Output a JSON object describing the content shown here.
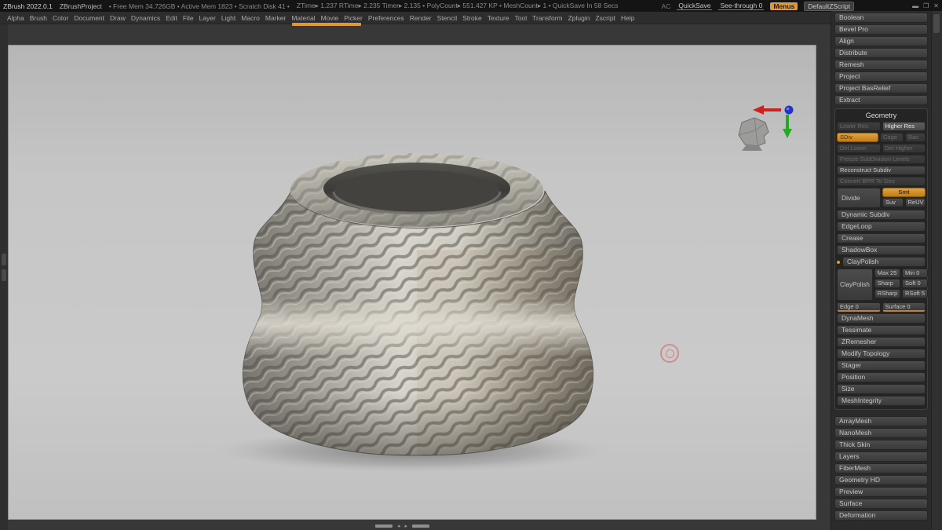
{
  "titlebar": {
    "app_name": "ZBrush 2022.0.1",
    "project_name": "ZBrushProject",
    "mem_stats": "• Free Mem 34.726GB  • Active Mem 1823  • Scratch Disk 41 •",
    "perf_stats": "ZTime▸ 1.237  RTime▸ 2.235  Timer▸ 2.135  • PolyCount▸ 551.427 KP  • MeshCount▸ 1  • QuickSave In 58 Secs",
    "ac_label": "AC",
    "quicksave_label": "QuickSave",
    "seethrough_label": "See-through 0",
    "menus_label": "Menus",
    "zscript_label": "DefaultZScript",
    "icons": {
      "minimize": "▬",
      "restore": "❐",
      "close": "✕"
    }
  },
  "menubar": {
    "items": [
      "Alpha",
      "Brush",
      "Color",
      "Document",
      "Draw",
      "Dynamics",
      "Edit",
      "File",
      "Layer",
      "Light",
      "Macro",
      "Marker",
      "Material",
      "Movie",
      "Picker",
      "Preferences",
      "Render",
      "Stencil",
      "Stroke",
      "Texture",
      "Tool",
      "Transform",
      "Zplugin",
      "Zscript",
      "Help"
    ]
  },
  "tool_panel": {
    "top_buttons": [
      "Boolean",
      "Bevel Pro",
      "Align",
      "Distribute",
      "Remesh",
      "Project",
      "Project BasRelief",
      "Extract"
    ],
    "geometry": {
      "header": "Geometry",
      "lower_res": "Lower Res",
      "higher_res": "Higher Res",
      "sdiv": "SDiv",
      "cage": "Cage",
      "bas": "Bas",
      "del_lower": "Del Lower",
      "del_higher": "Del Higher",
      "freeze": "Freeze SubDivision Levels",
      "reconstruct": "Reconstruct Subdiv",
      "convert_bpr": "Convert BPR To Geo",
      "divide": "Divide",
      "smt": "Smt",
      "suv": "Suv",
      "reuv": "ReUV",
      "mid_buttons": [
        "Dynamic Subdiv",
        "EdgeLoop",
        "Crease",
        "ShadowBox"
      ],
      "claypolish": {
        "header": "ClayPolish",
        "button": "ClayPolish",
        "max": "Max 25",
        "min": "Min 0",
        "sharp": "Sharp",
        "soft": "Soft 0",
        "rsharp": "RSharp",
        "rsoft": "RSoft 5",
        "edge": "Edge 0",
        "surface": "Surface 0"
      },
      "lower_buttons": [
        "DynaMesh",
        "Tessimate",
        "ZRemesher",
        "Modify Topology",
        "Stager",
        "Position",
        "Size",
        "MeshIntegrity"
      ]
    },
    "bottom_sections": [
      "ArrayMesh",
      "NanoMesh",
      "Thick Skin",
      "Layers",
      "FiberMesh",
      "Geometry HD",
      "Preview",
      "Surface",
      "Deformation"
    ]
  },
  "colors": {
    "accent_orange": "#e09a33",
    "axis_red": "#cc2222",
    "axis_green": "#22aa22",
    "axis_blue": "#2233cc",
    "canvas_gray": "#c6c6c6"
  }
}
